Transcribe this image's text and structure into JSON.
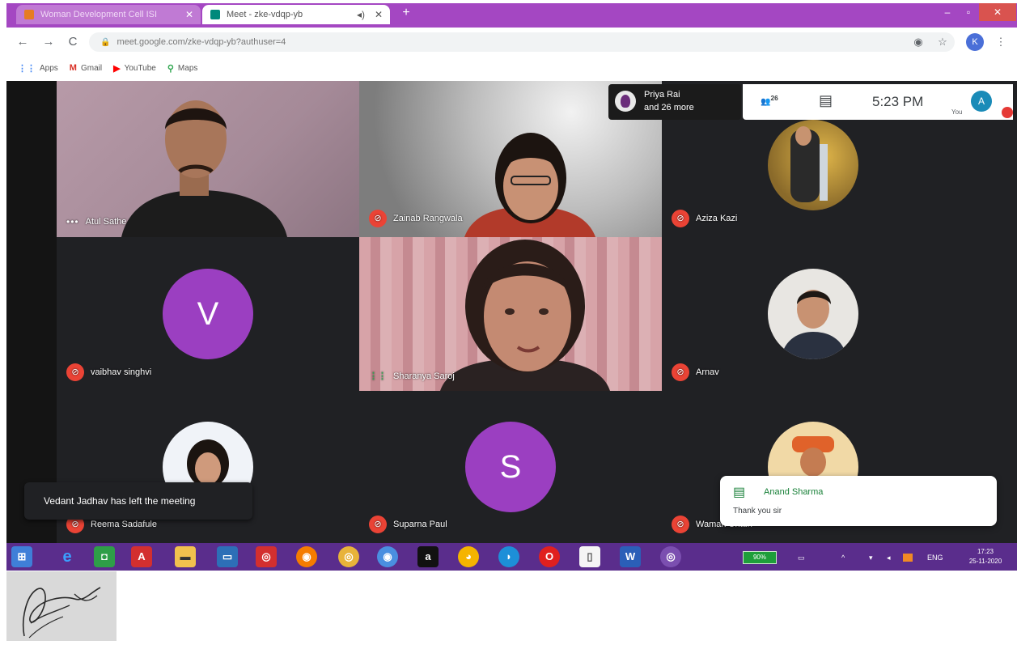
{
  "browser": {
    "tabs": [
      {
        "title": "Woman Development Cell ISI"
      },
      {
        "title": "Meet - zke-vdqp-yb"
      }
    ],
    "url": "meet.google.com/zke-vdqp-yb?authuser=4",
    "profile_initial": "K",
    "bookmarks": [
      {
        "label": "Apps",
        "icon": "apps-icon"
      },
      {
        "label": "Gmail",
        "icon": "gmail-icon"
      },
      {
        "label": "YouTube",
        "icon": "youtube-icon"
      },
      {
        "label": "Maps",
        "icon": "maps-icon"
      }
    ]
  },
  "meet": {
    "presenter_chip": {
      "line1": "Priya Rai",
      "line2": "and 26 more"
    },
    "people_count": "26",
    "time": "5:23 PM",
    "you_label": "You",
    "user_initial": "A",
    "tiles": [
      {
        "name": "Atul Sathe",
        "type": "video",
        "muted": false
      },
      {
        "name": "Zainab Rangwala",
        "type": "video",
        "muted": true
      },
      {
        "name": "Aziza Kazi",
        "type": "photo",
        "muted": true
      },
      {
        "name": "vaibhav singhvi",
        "type": "letter",
        "letter": "V",
        "muted": true
      },
      {
        "name": "Sharanya Saroj",
        "type": "video",
        "muted": false,
        "speaking": true
      },
      {
        "name": "Arnav",
        "type": "photo",
        "muted": true
      },
      {
        "name": "Reema Sadafule",
        "type": "photo",
        "muted": true
      },
      {
        "name": "Suparna Paul",
        "type": "letter",
        "letter": "S",
        "muted": true
      },
      {
        "name": "Waman Untun",
        "type": "photo",
        "muted": true
      }
    ],
    "left_toast": "Vedant Jadhav has left the meeting",
    "chat_toast": {
      "from": "Anand Sharma",
      "message": "Thank you sir"
    }
  },
  "taskbar": {
    "battery": "90%",
    "language": "ENG",
    "time": "17:23",
    "date": "25-11-2020"
  },
  "colors": {
    "chrome_frame": "#a447c2",
    "meet_background": "#202124",
    "taskbar": "#5a2d8c",
    "avatar_purple": "#9b3fc1",
    "mic_off_red": "#ea4335"
  }
}
